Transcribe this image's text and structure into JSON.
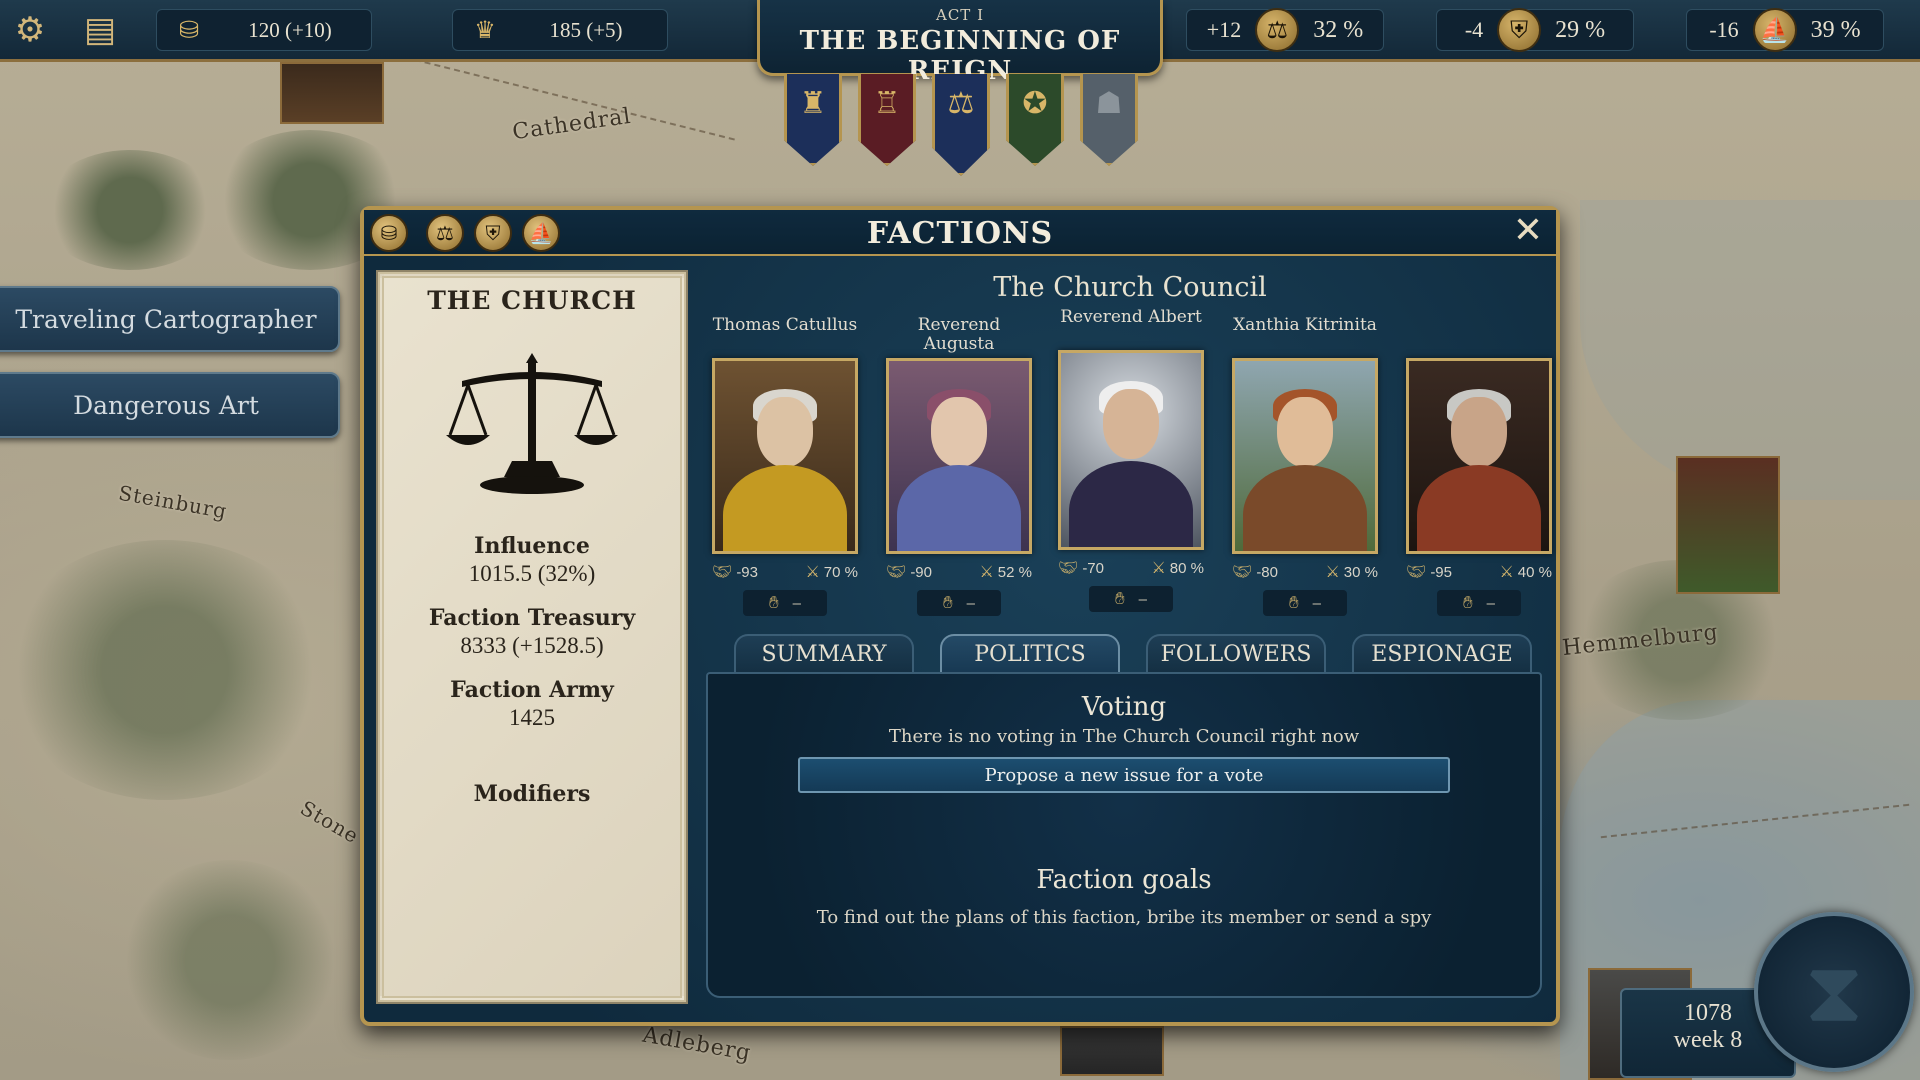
{
  "topbar": {
    "gold": "120 (+10)",
    "crowns": "185 (+5)",
    "act": "ACT I",
    "act_title": "THE BEGINNING OF REIGN",
    "stats": [
      {
        "delta": "+12",
        "icon": "scales-icon",
        "pct": "32 %"
      },
      {
        "delta": "-4",
        "icon": "shield-icon",
        "pct": "29 %"
      },
      {
        "delta": "-16",
        "icon": "ship-icon",
        "pct": "39 %"
      }
    ]
  },
  "side_events": [
    "Traveling Cartographer",
    "Dangerous Art"
  ],
  "map_labels": {
    "cathedral": "Cathedral",
    "steinburg": "Steinburg",
    "hemmelburg": "Hemmelburg",
    "adleberg": "Adleberg",
    "stone": "Stone"
  },
  "dialog": {
    "title": "FACTIONS",
    "faction": {
      "name": "THE CHURCH",
      "influence_label": "Influence",
      "influence_value": "1015.5 (32%)",
      "treasury_label": "Faction Treasury",
      "treasury_value": "8333 (+1528.5)",
      "army_label": "Faction Army",
      "army_value": "1425",
      "modifiers_label": "Modifiers"
    },
    "council_title": "The Church Council",
    "members": [
      {
        "name": "Thomas Catullus",
        "loyalty": "-93",
        "chance": "70 %",
        "bribe": "–"
      },
      {
        "name": "Reverend Augusta",
        "loyalty": "-90",
        "chance": "52 %",
        "bribe": "–"
      },
      {
        "name": "Reverend Albert",
        "loyalty": "-70",
        "chance": "80 %",
        "bribe": "–"
      },
      {
        "name": "Xanthia Kitrinita",
        "loyalty": "-80",
        "chance": "30 %",
        "bribe": "–"
      },
      {
        "name": "",
        "loyalty": "-95",
        "chance": "40 %",
        "bribe": "–"
      }
    ],
    "tabs": [
      "SUMMARY",
      "POLITICS",
      "FOLLOWERS",
      "ESPIONAGE"
    ],
    "active_tab": "POLITICS",
    "voting_title": "Voting",
    "voting_text": "There is no voting in The Church Council right now",
    "propose_button": "Propose a new issue for a vote",
    "goals_title": "Faction goals",
    "goals_text": "To find out the plans of this faction, bribe its member or send a spy"
  },
  "date": {
    "year": "1078",
    "week": "week 8"
  }
}
